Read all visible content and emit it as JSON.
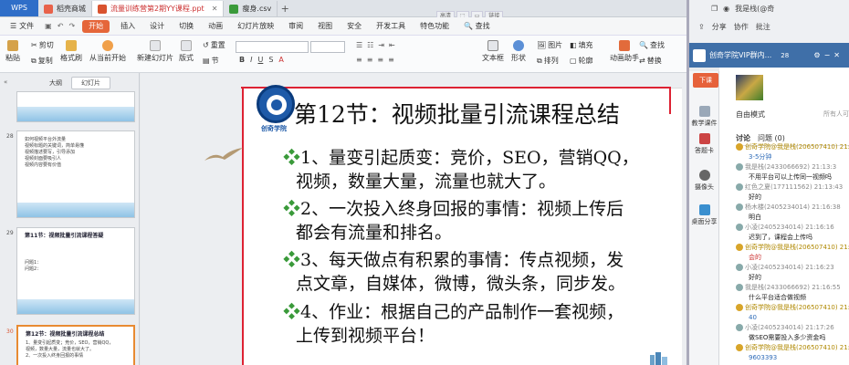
{
  "titlebar": {
    "app": "WPS",
    "tabs": [
      {
        "label": "稻壳商城",
        "color": "#e8624a",
        "active": false
      },
      {
        "label": "流量训练营第2期YY课程.ppt",
        "color": "#d9532f",
        "active": true
      },
      {
        "label": "瘦身.csv",
        "color": "#3a9a3a",
        "active": false
      }
    ],
    "view_buttons": [
      "高清",
      "",
      "",
      "链接"
    ]
  },
  "menu": {
    "file": "文件",
    "items": [
      "开始",
      "插入",
      "设计",
      "切换",
      "动画",
      "幻灯片放映",
      "审阅",
      "视图",
      "安全",
      "开发工具",
      "特色功能"
    ],
    "search": "查找"
  },
  "toolbar": {
    "paste": "粘贴",
    "cut": "剪切",
    "copy": "复制",
    "format_painter": "格式刷",
    "from_current": "从当前开始",
    "new_slide": "新建幻灯片",
    "layout": "版式",
    "reset": "重置",
    "section": "节",
    "textbox": "文本框",
    "shape": "形状",
    "arrange": "排列",
    "image": "图片",
    "fill": "填充",
    "outline": "轮廓",
    "find": "查找",
    "replace": "替换",
    "select": "选择",
    "animation_helper": "动画助手",
    "text_tools": "文本工具"
  },
  "right_header": {
    "user": "我是栈(@奇",
    "share": "分享",
    "collab": "协作",
    "comment": "批注"
  },
  "left_panel": {
    "tabs": [
      "大纲",
      "幻灯片"
    ],
    "slides": [
      {
        "num": "",
        "title": "",
        "lines": []
      },
      {
        "num": "28",
        "title": "",
        "lines": [
          "如何视频平台外流量",
          "视频标题的关键词，简单易懂",
          "视频描述要写，引导添加",
          "视频封面要吸引人",
          "视频内容要有价值"
        ]
      },
      {
        "num": "29",
        "title": "第11节：视频批量引流课程答疑",
        "lines": [
          "问题1：",
          "问题2："
        ]
      },
      {
        "num": "30",
        "title": "第12节：视频批量引流课程总结",
        "lines": [
          "1、量变引起质变；竞价，SEO，营销QQ，",
          "视频，数量大量，流量也就大了。",
          "2、一次投入终身回报的事情"
        ]
      }
    ]
  },
  "slide": {
    "logo_text": "创奇学院",
    "title": "第12节：视频批量引流课程总结",
    "bullets": [
      [
        "1、量变引起质变：竞价，SEO，营销QQ，",
        "视频，数量大量，流量也就大了。"
      ],
      [
        "2、一次投入终身回报的事情：视频上传后",
        "都会有流量和排名。"
      ],
      [
        "3、每天做点有积累的事情：传点视频，发",
        "点文章，自媒体，微博，微头条，同步发。"
      ],
      [
        "4、作业：根据自己的产品制作一套视频，",
        "上传到视频平台！"
      ]
    ]
  },
  "side_tools": {
    "download": "下课",
    "items": [
      "教学课件",
      "答题卡",
      "摄像头",
      "桌面分享"
    ]
  },
  "chat": {
    "header": "创奇学院VIP群内...",
    "count": "28",
    "mode": "自由模式",
    "all_mode": "所有人可",
    "discussion_tabs": [
      "讨论",
      "问题 (0)"
    ],
    "messages": [
      {
        "type": "name",
        "text": "创奇学院@我是栈(206507410) 21:16:",
        "cls": "gold"
      },
      {
        "type": "txt",
        "text": "3-5分钟",
        "cls": "blue"
      },
      {
        "type": "name",
        "text": "我是栈(2433066692) 21:13:3",
        "cls": ""
      },
      {
        "type": "txt",
        "text": "不用平台可以上传同一视频吗",
        "cls": ""
      },
      {
        "type": "name",
        "text": "红色之夏(177111562) 21:13:43",
        "cls": ""
      },
      {
        "type": "txt",
        "text": "好的",
        "cls": ""
      },
      {
        "type": "name",
        "text": "杨木楼(2405234014) 21:16:38",
        "cls": ""
      },
      {
        "type": "txt",
        "text": "明白",
        "cls": ""
      },
      {
        "type": "name",
        "text": "小凌(2405234014) 21:16:16",
        "cls": ""
      },
      {
        "type": "txt",
        "text": "迟到了，课程会上传吗",
        "cls": ""
      },
      {
        "type": "name",
        "text": "创奇学院@我是栈(206507410) 21:16:",
        "cls": "gold"
      },
      {
        "type": "txt",
        "text": "会的",
        "cls": "red"
      },
      {
        "type": "name",
        "text": "小凌(2405234014) 21:16:23",
        "cls": ""
      },
      {
        "type": "txt",
        "text": "好的",
        "cls": ""
      },
      {
        "type": "name",
        "text": "我是栈(2433066692) 21:16:55",
        "cls": ""
      },
      {
        "type": "txt",
        "text": "什么平台适合做视频",
        "cls": ""
      },
      {
        "type": "name",
        "text": "创奇学院@我是栈(206507410) 21:16:",
        "cls": "gold"
      },
      {
        "type": "txt",
        "text": "40",
        "cls": "blue"
      },
      {
        "type": "name",
        "text": "小凌(2405234014) 21:17:26",
        "cls": ""
      },
      {
        "type": "txt",
        "text": "做SEO需要投入多少资金吗",
        "cls": ""
      },
      {
        "type": "name",
        "text": "创奇学院@我是栈(206507410) 21:17:",
        "cls": "gold"
      },
      {
        "type": "txt",
        "text": "9603393",
        "cls": "blue"
      }
    ]
  },
  "colors": {
    "accent": "#e5663a",
    "slide_border": "#dd2233",
    "chat_header": "#3f6fa8"
  }
}
